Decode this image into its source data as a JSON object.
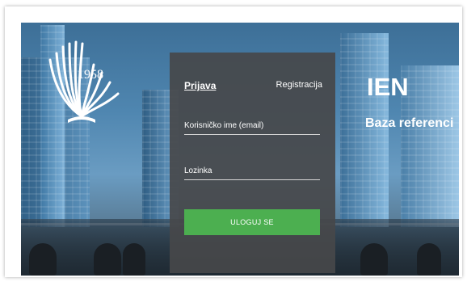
{
  "logo": {
    "year": "1958",
    "icon": "open-book-rays-icon"
  },
  "login": {
    "tab_login": "Prijava",
    "tab_register": "Registracija",
    "email_placeholder": "Korisničko ime (email)",
    "password_placeholder": "Lozinka",
    "submit_label": "ULOGUJ SE"
  },
  "brand": {
    "title": "IEN",
    "subtitle": "Baza referenci"
  },
  "colors": {
    "panel_bg": "#464849",
    "button_green": "#4caf50",
    "text": "#ffffff"
  }
}
